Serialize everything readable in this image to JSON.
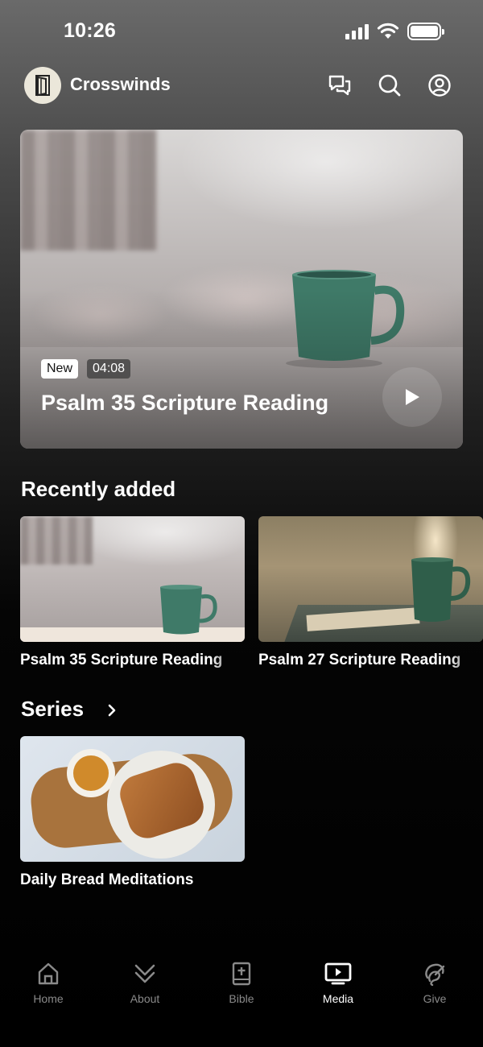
{
  "status_bar": {
    "time": "10:26"
  },
  "header": {
    "app_name": "Crosswinds"
  },
  "hero": {
    "badge_new": "New",
    "duration": "04:08",
    "title": "Psalm 35 Scripture Reading"
  },
  "recently_added": {
    "heading": "Recently added",
    "items": [
      {
        "title": "Psalm 35 Scripture Reading"
      },
      {
        "title": "Psalm 27 Scripture Reading"
      }
    ]
  },
  "series": {
    "heading": "Series",
    "items": [
      {
        "title": "Daily Bread Meditations"
      }
    ]
  },
  "bottom_nav": {
    "active": "Media",
    "items": [
      {
        "label": "Home",
        "icon": "home-icon"
      },
      {
        "label": "About",
        "icon": "chevrons-down-icon"
      },
      {
        "label": "Bible",
        "icon": "bible-icon"
      },
      {
        "label": "Media",
        "icon": "media-icon"
      },
      {
        "label": "Give",
        "icon": "give-icon"
      }
    ]
  },
  "colors": {
    "accent_active": "#ffffff",
    "inactive": "#8a8a8a",
    "mug_green": "#3f7a68"
  }
}
